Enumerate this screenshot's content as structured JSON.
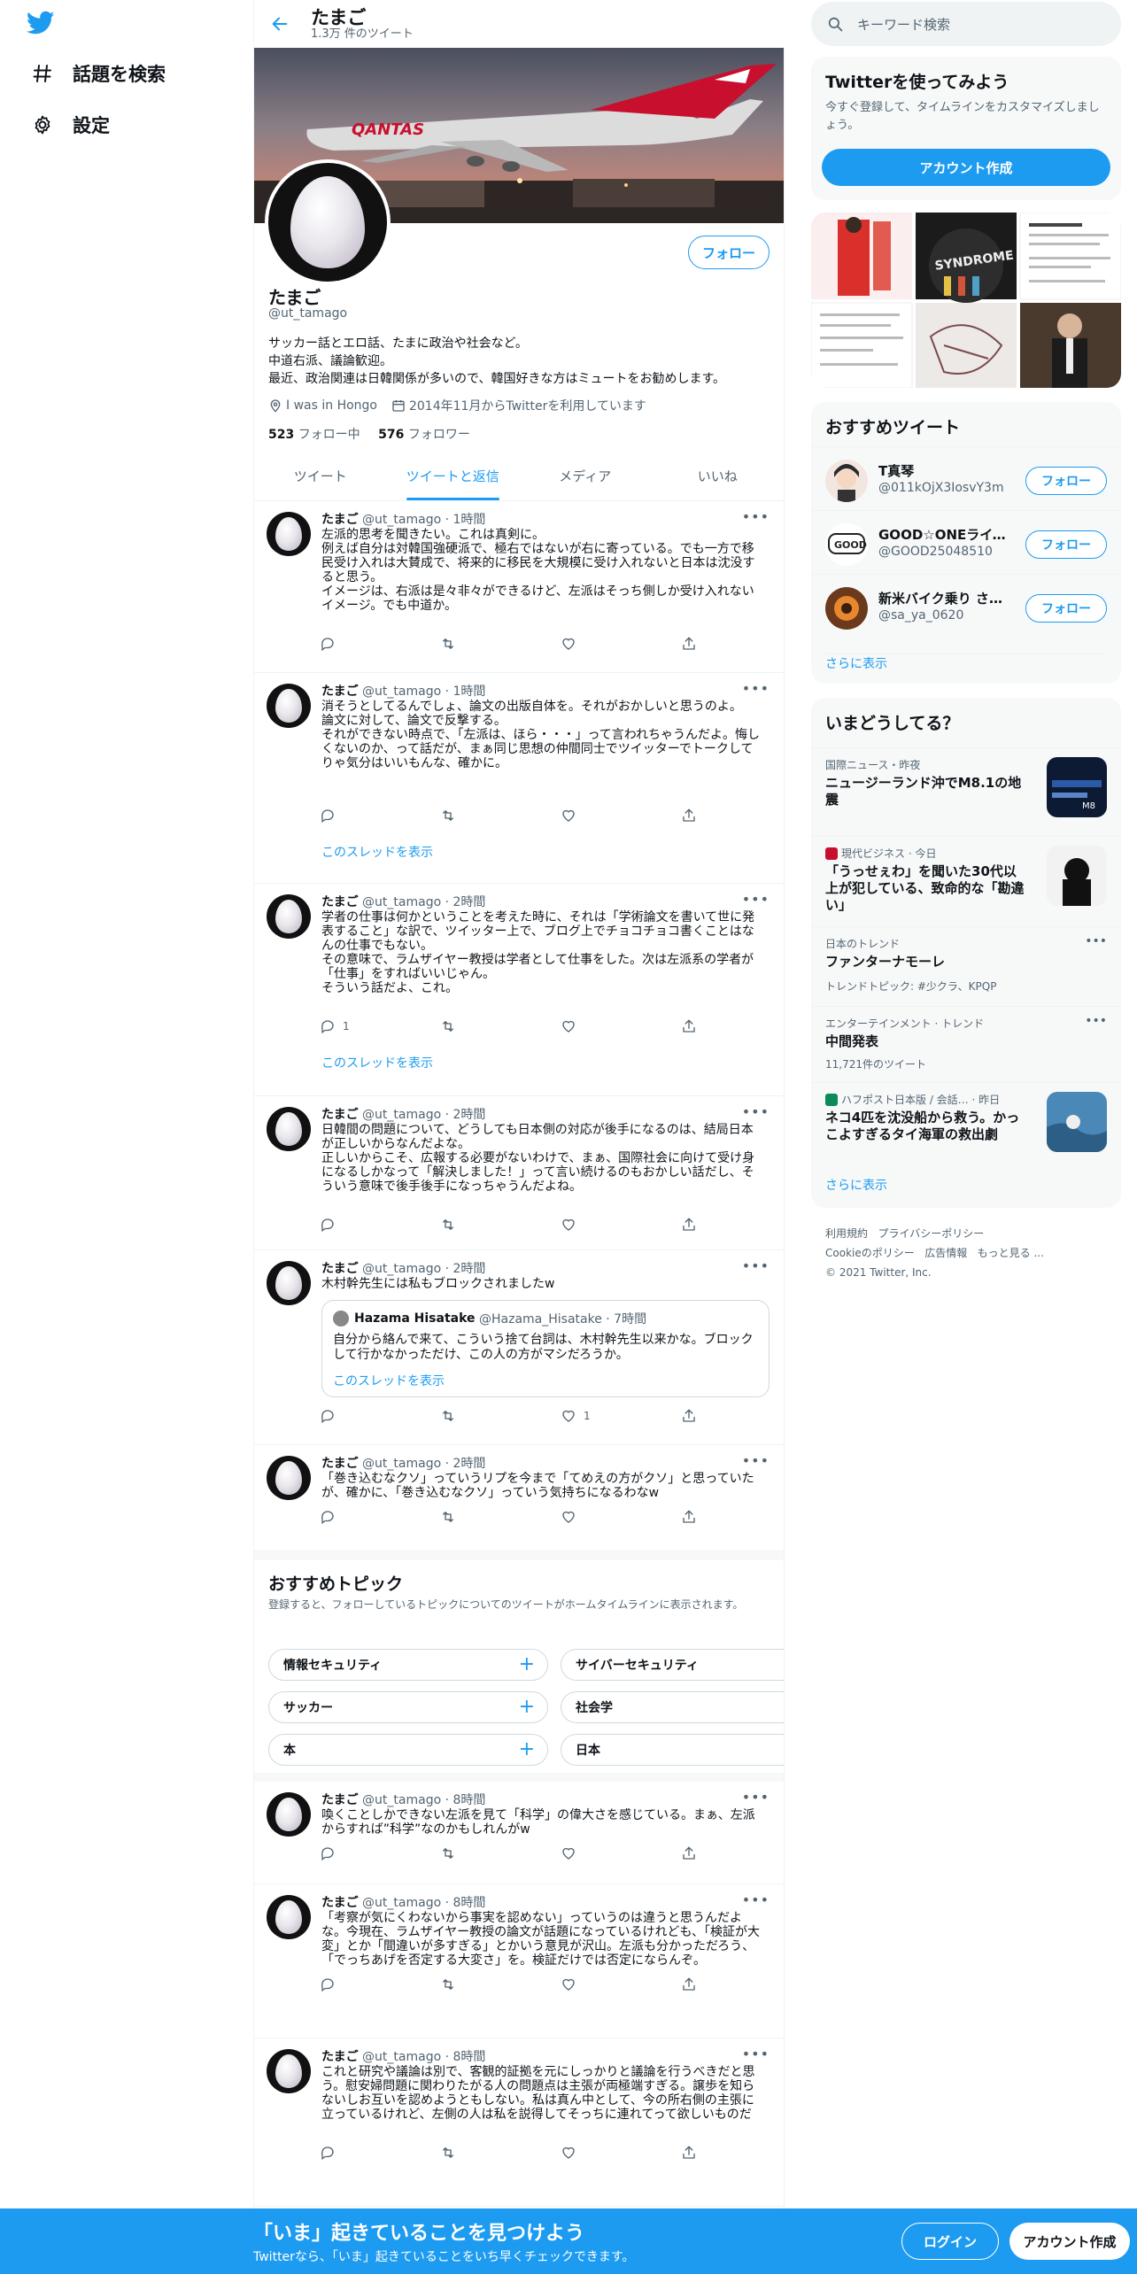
{
  "nav": {
    "explore_label": "話題を検索",
    "settings_label": "設定"
  },
  "profile": {
    "name": "たまご",
    "tweet_count": "1.3万 件のツイート",
    "handle": "@ut_tamago",
    "bio": "サッカー話とエロ話、たまに政治や社会など。\n中道右派、議論歓迎。\n最近、政治関連は日韓関係が多いので、韓国好きな方はミュートをお勧めします。",
    "location": "I was in Hongo",
    "joined": "2014年11月からTwitterを利用しています",
    "following_count": "523",
    "following_label": "フォロー中",
    "followers_count": "576",
    "followers_label": "フォロワー",
    "follow_button": "フォロー"
  },
  "tabs": [
    {
      "label": "ツイート"
    },
    {
      "label": "ツイートと返信"
    },
    {
      "label": "メディア"
    },
    {
      "label": "いいね"
    }
  ],
  "tweets": [
    {
      "name": "たまご",
      "meta": "@ut_tamago · 1時間",
      "text": "左派的思考を聞きたい。これは真剣に。\n例えば自分は対韓国強硬派で、極右ではないが右に寄っている。でも一方で移民受け入れは大賛成で、将来的に移民を大規模に受け入れないと日本は沈没すると思う。\nイメージは、右派は是々非々ができるけど、左派はそっち側しか受け入れないイメージ。でも中道か。",
      "replies": "",
      "retweets": "",
      "likes": ""
    },
    {
      "name": "たまご",
      "meta": "@ut_tamago · 1時間",
      "text": "消そうとしてるんでしょ、論文の出版自体を。それがおかしいと思うのよ。\n論文に対して、論文で反撃する。\nそれができない時点で、「左派は、ほら・・・」って言われちゃうんだよ。悔しくないのか、って話だが、まぁ同じ思想の仲間同士でツイッターでトークしてりゃ気分はいいもんな、確かに。",
      "replies": "",
      "retweets": "",
      "likes": "",
      "show_thread": "このスレッドを表示"
    },
    {
      "name": "たまご",
      "meta": "@ut_tamago · 2時間",
      "text": "学者の仕事は何かということを考えた時に、それは「学術論文を書いて世に発表すること」な訳で、ツイッター上で、ブログ上でチョコチョコ書くことはなんの仕事でもない。\nその意味で、ラムザイヤー教授は学者として仕事をした。次は左派系の学者が「仕事」をすればいいじゃん。\nそういう話だよ、これ。",
      "replies": "1",
      "retweets": "",
      "likes": "",
      "show_thread": "このスレッドを表示"
    },
    {
      "name": "たまご",
      "meta": "@ut_tamago · 2時間",
      "text": "日韓間の問題について、どうしても日本側の対応が後手になるのは、結局日本が正しいからなんだよな。\n正しいからこそ、広報する必要がないわけで、まぁ、国際社会に向けて受け身になるしかなって「解決しました！」って言い続けるのもおかしい話だし、そういう意味で後手後手になっちゃうんだよね。",
      "replies": "",
      "retweets": "",
      "likes": ""
    },
    {
      "name": "たまご",
      "meta": "@ut_tamago · 2時間",
      "text": "木村幹先生には私もブロックされましたw",
      "replies": "",
      "retweets": "",
      "likes": "1",
      "quote": {
        "name": "Hazama Hisatake",
        "meta": "@Hazama_Hisatake · 7時間",
        "text": "自分から絡んで来て、こういう捨て台詞は、木村幹先生以来かな。ブロックして行かなかっただけ、この人の方がマシだろうか。",
        "show_thread": "このスレッドを表示"
      }
    },
    {
      "name": "たまご",
      "meta": "@ut_tamago · 2時間",
      "text": "「巻き込むなクソ」っていうリプを今まで「てめえの方がクソ」と思っていたが、確かに、「巻き込むなクソ」っていう気持ちになるわなw",
      "replies": "",
      "retweets": "",
      "likes": ""
    },
    {
      "name": "たまご",
      "meta": "@ut_tamago · 8時間",
      "text": "喚くことしかできない左派を見て「科学」の偉大さを感じている。まぁ、左派からすれば”科学”なのかもしれんがw",
      "replies": "",
      "retweets": "",
      "likes": ""
    },
    {
      "name": "たまご",
      "meta": "@ut_tamago · 8時間",
      "text": "「考察が気にくわないから事実を認めない」っていうのは違うと思うんだよな。今現在、ラムザイヤー教授の論文が話題になっているけれども、「検証が大変」とか「間違いが多すぎる」とかいう意見が沢山。左派も分かっただろう、「でっちあげを否定する大変さ」を。検証だけでは否定にならんぞ。",
      "replies": "",
      "retweets": "",
      "likes": ""
    },
    {
      "name": "たまご",
      "meta": "@ut_tamago · 8時間",
      "text": "これと研究や議論は別で、客観的証拠を元にしっかりと議論を行うべきだと思う。慰安婦問題に関わりたがる人の問題点は主張が両極端すぎる。譲歩を知らないしお互いを認めようともしない。私は真ん中として、今の所右側の主張に立っているけれど、左側の人は私を説得してそっちに連れてって欲しいものだ",
      "replies": "",
      "retweets": "",
      "likes": ""
    }
  ],
  "topics": {
    "title": "おすすめトピック",
    "subtitle": "登録すると、フォローしているトピックについてのツイートがホームタイムラインに表示されます。",
    "items": [
      "情報セキュリティ",
      "サイバーセキュリティ",
      "サッカー",
      "社会学",
      "本",
      "日本"
    ]
  },
  "search": {
    "placeholder": "キーワード検索"
  },
  "signup": {
    "title": "Twitterを使ってみよう",
    "text": "今すぐ登録して、タイムラインをカスタマイズしましょう。",
    "button": "アカウント作成"
  },
  "recommended": {
    "title": "おすすめツイート",
    "users": [
      {
        "name": "T真琴",
        "handle": "@011kOjX3IosvY3m",
        "button": "フォロー"
      },
      {
        "name": "GOOD☆ONEライダー…",
        "handle": "@GOOD25048510",
        "button": "フォロー"
      },
      {
        "name": "新米バイク乗り さぁ…",
        "handle": "@sa_ya_0620",
        "button": "フォロー"
      }
    ],
    "more": "さらに表示"
  },
  "trends": {
    "title": "いまどうしてる？",
    "items": [
      {
        "context": "国際ニュース・昨夜",
        "title": "ニュージーランド沖でM8.1の地震"
      },
      {
        "context": "現代ビジネス · 今日",
        "title": "「うっせぇわ」を聞いた30代以上が犯している、致命的な「勘違い」"
      },
      {
        "context": "日本のトレンド",
        "title": "ファンターナモーレ",
        "extra": "トレンドトピック: #少クラ、KPQP"
      },
      {
        "context": "エンターテインメント · トレンド",
        "title": "中間発表",
        "extra": "11,721件のツイート"
      },
      {
        "context": "ハフポスト日本版 / 会話… · 昨日",
        "title": "ネコ4匹を沈没船から救う。かっこよすぎるタイ海軍の救出劇"
      }
    ],
    "more": "さらに表示"
  },
  "footer": {
    "links": [
      "利用規約",
      "プライバシーポリシー",
      "Cookieのポリシー",
      "広告情報",
      "もっと見る ..."
    ],
    "copyright": "© 2021 Twitter, Inc."
  },
  "bottom": {
    "title": "「いま」起きていることを見つけよう",
    "subtitle": "Twitterなら、「いま」起きていることをいち早くチェックできます。",
    "login": "ログイン",
    "signup": "アカウント作成"
  },
  "colors": {
    "accent": "#1d9bf0",
    "text": "#0f1419",
    "muted": "#536471"
  }
}
